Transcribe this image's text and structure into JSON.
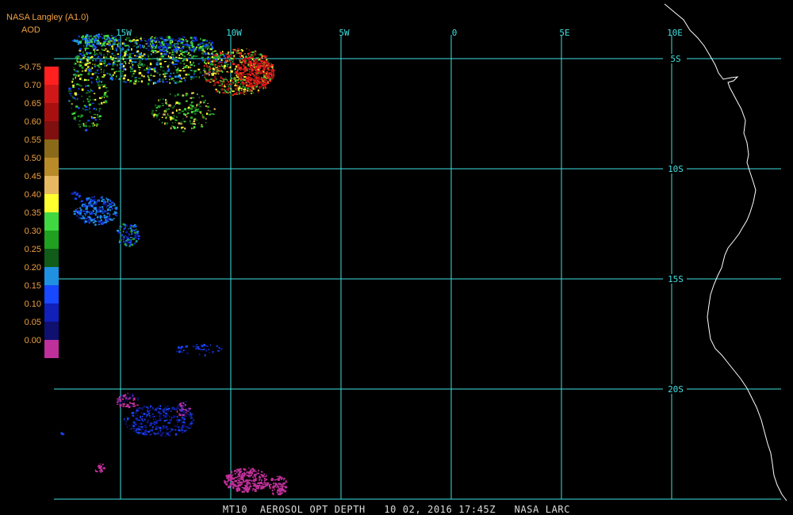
{
  "product": {
    "source": "NASA Langley (A1.0)",
    "parameter": "AOD"
  },
  "legend": {
    "labels": [
      ">0.75",
      "0.70",
      "0.65",
      "0.60",
      "0.55",
      "0.50",
      "0.45",
      "0.40",
      "0.35",
      "0.30",
      "0.25",
      "0.20",
      "0.15",
      "0.10",
      "0.05",
      "0.00"
    ],
    "colors": [
      "#ff2020",
      "#d01818",
      "#a81010",
      "#801010",
      "#8a6a18",
      "#b88a28",
      "#e8b860",
      "#ffff30",
      "#40d840",
      "#20a020",
      "#105c18",
      "#2090e0",
      "#1848ff",
      "#1020b8",
      "#101070",
      "#c0309a"
    ]
  },
  "map": {
    "lon_labels": [
      "15W",
      "10W",
      "5W",
      "0",
      "5E",
      "10E"
    ],
    "lat_labels": [
      "5S",
      "10S",
      "15S",
      "20S"
    ],
    "grid_color": "#40e0e0",
    "coast_color": "#ffffff"
  },
  "footer": "MT10  AEROSOL OPT DEPTH   10 02, 2016 17:45Z   NASA LARC"
}
